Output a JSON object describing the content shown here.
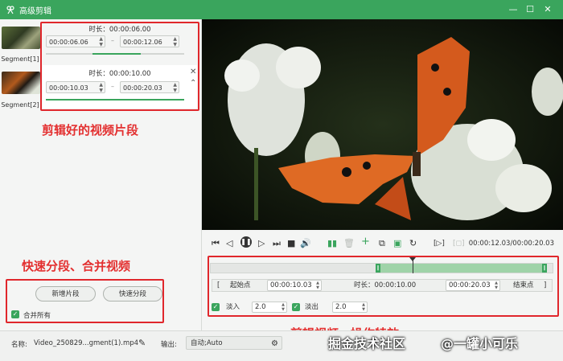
{
  "window": {
    "title": "高级剪辑"
  },
  "segments": [
    {
      "label": "Segment[1]",
      "duration_text": "时长：00:00:06.00",
      "start": "00:00:06.06",
      "end": "00:00:12.06",
      "close": ""
    },
    {
      "label": "Segment[2]",
      "duration_text": "时长：00:00:10.00",
      "start": "00:00:10.03",
      "end": "00:00:20.03",
      "close": "✕"
    }
  ],
  "left_buttons": {
    "add_segment": "新增片段",
    "quick_split": "快速分段",
    "merge_all": "合并所有"
  },
  "annotations": {
    "segments_note": "剪辑好的视频片段",
    "split_merge_note": "快速分段、合并视频",
    "edit_note": "剪辑视频、操作特效"
  },
  "player": {
    "timecode": "00:00:12.03/00:00:20.03",
    "progress": 0.6
  },
  "trim": {
    "start_label": "起始点",
    "start_value": "00:00:10.03",
    "duration_label": "时长：00:00:10.00",
    "end_value": "00:00:20.03",
    "end_label": "结束点",
    "fade_in_label": "淡入",
    "fade_in_value": "2.0",
    "fade_out_label": "淡出",
    "fade_out_value": "2.0"
  },
  "bottom_bar": {
    "name_label": "名称:",
    "file_name": "Video_250829...gment(1).mp4",
    "output_label": "输出:",
    "output_value": "自动;Auto"
  },
  "watermark": {
    "text1": "掘金技术社区",
    "text2": "@一罐小可乐"
  },
  "colors": {
    "accent": "#3aa55d",
    "annotation_red": "#e0272c"
  }
}
